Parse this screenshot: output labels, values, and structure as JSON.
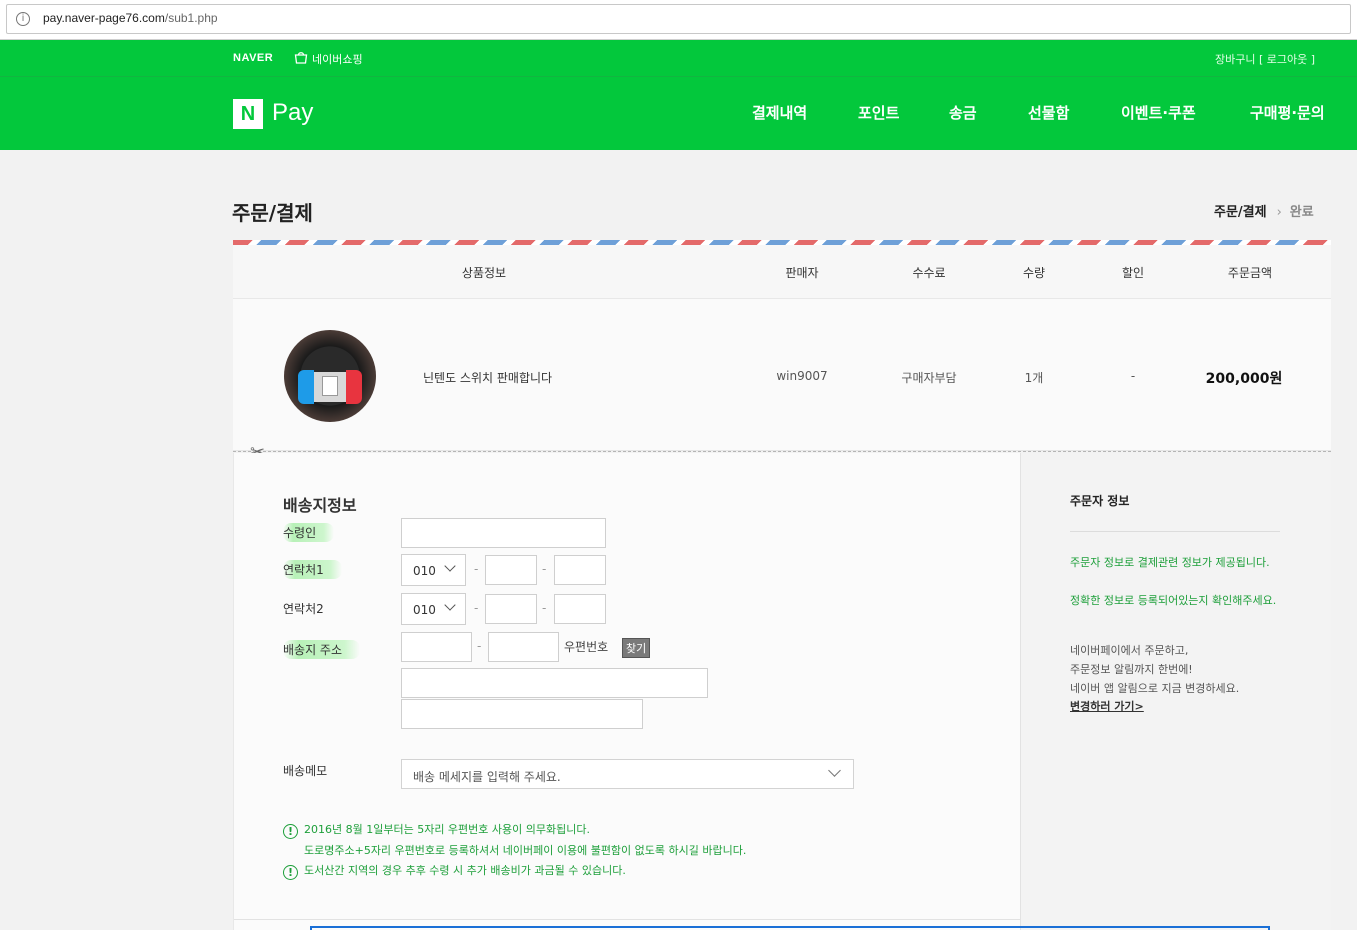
{
  "browser": {
    "url_host": "pay.naver-page76.com",
    "url_path": "/sub1.php"
  },
  "gnb": {
    "naver": "NAVER",
    "shopping": "네이버쇼핑",
    "util": "장바구니 [ 로그아웃 ]",
    "logo_letter": "N",
    "pay": "Pay",
    "menu": [
      "결제내역",
      "포인트",
      "송금",
      "선물함",
      "이벤트·쿠폰",
      "구매평·문의"
    ]
  },
  "page": {
    "title": "주문/결제",
    "step_current": "주문/결제",
    "step_next": "완료"
  },
  "order_table": {
    "headers": [
      "상품정보",
      "판매자",
      "수수료",
      "수량",
      "할인",
      "주문금액"
    ],
    "row": {
      "product_name": "닌텐도 스위치 판매합니다",
      "seller": "win9007",
      "fee": "구매자부담",
      "quantity": "1개",
      "discount": "-",
      "price": "200,000원"
    }
  },
  "shipping": {
    "title": "배송지정보",
    "recipient_label": "수령인",
    "phone1_label": "연락처1",
    "phone2_label": "연락처2",
    "address_label": "배송지 주소",
    "phone_prefix": "010",
    "dash": "-",
    "postcode_label": "우편번호",
    "find_button": "찾기",
    "memo_label": "배송메모",
    "memo_placeholder": "배송 메세지를 입력해 주세요."
  },
  "notices": {
    "n1": "2016년 8월 1일부터는 5자리 우편번호 사용이 의무화됩니다.",
    "n1_sub": "도로명주소+5자리 우편번호로 등록하셔서 네이버페이 이용에 불편함이 없도록 하시길 바랍니다.",
    "n2": "도서산간 지역의 경우 추후 수령 시 추가 배송비가 과금될 수 있습니다."
  },
  "orderer": {
    "title": "주문자 정보",
    "green_1": "주문자 정보로 결제관련 정보가 제공됩니다.",
    "green_2": "정확한 정보로 등록되어있는지 확인해주세요.",
    "gray_1": "네이버페이에서 주문하고,",
    "gray_2": "주문정보 알림까지 한번에!",
    "gray_3": "네이버 앱 알림으로 지금 변경하세요.",
    "link": "변경하러 가기>"
  },
  "colors": {
    "brand_green": "#03c83c",
    "notice_green": "#1d9f3a"
  }
}
